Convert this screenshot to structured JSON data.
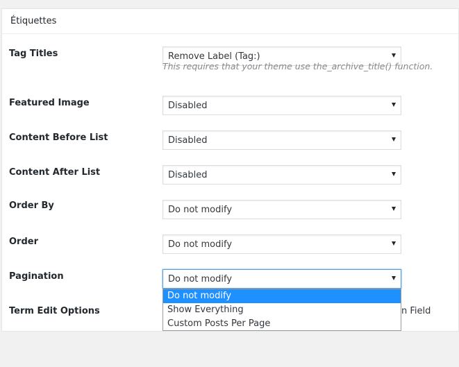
{
  "panel": {
    "title": "Étiquettes"
  },
  "rows": [
    {
      "label": "Tag Titles",
      "value": "Remove Label (Tag:)"
    },
    {
      "label": "Featured Image",
      "value": "Disabled"
    },
    {
      "label": "Content Before List",
      "value": "Disabled"
    },
    {
      "label": "Content After List",
      "value": "Disabled"
    },
    {
      "label": "Order By",
      "value": "Do not modify"
    },
    {
      "label": "Order",
      "value": "Do not modify"
    },
    {
      "label": "Pagination",
      "value": "Do not modify"
    },
    {
      "label": "Term Edit Options",
      "partial_text": "n Field"
    }
  ],
  "hint": "This requires that your theme use the_archive_title() function.",
  "pagination_dropdown": {
    "options": [
      "Do not modify",
      "Show Everything",
      "Custom Posts Per Page"
    ],
    "selected_index": 0
  },
  "colors": {
    "page_bg": "#f1f1f1",
    "panel_bg": "#ffffff",
    "selected_option_bg": "#1e90ff",
    "focus_border": "#5b9dd9",
    "hint_text": "#888888"
  },
  "icons": {
    "select_arrow": "caret-down-icon"
  }
}
